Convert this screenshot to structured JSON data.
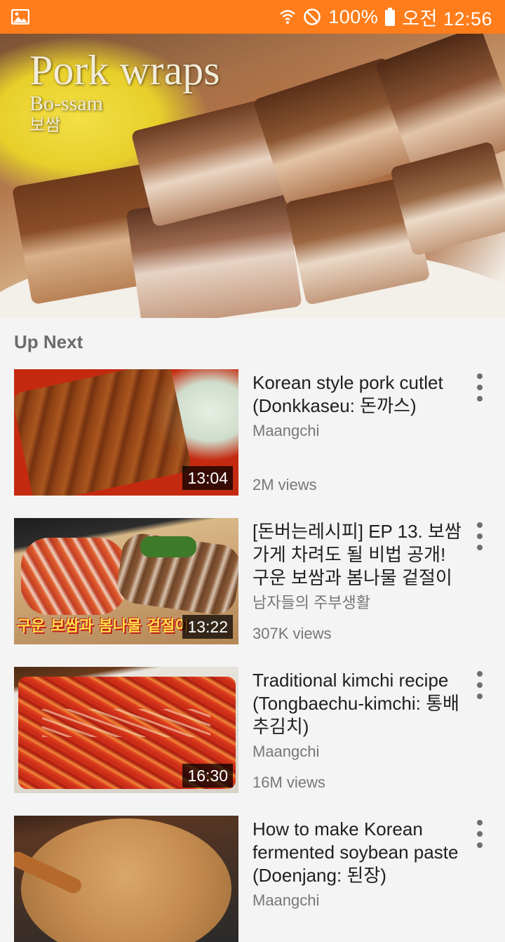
{
  "status_bar": {
    "battery": "100%",
    "time": "오전 12:56"
  },
  "player": {
    "title": "Pork wraps",
    "subtitle": "Bo-ssam",
    "subtitle_korean": "보쌈"
  },
  "section": {
    "title": "Up Next"
  },
  "videos": [
    {
      "title": "Korean style pork cutlet (Donkkaseu: 돈까스)",
      "channel": "Maangchi",
      "views": "2M views",
      "duration": "13:04"
    },
    {
      "title": "[돈버는레시피] EP 13. 보쌈 가게 차려도 될 비법 공개! 구운 보쌈과 봄나물 겉절이",
      "channel": "남자들의 주부생활",
      "views": "307K views",
      "duration": "13:22",
      "thumb_caption": "구운 보쌈과 봄나물 겉절이"
    },
    {
      "title": "Traditional kimchi recipe (Tongbaechu-kimchi: 통배추김치)",
      "channel": "Maangchi",
      "views": "16M views",
      "duration": "16:30"
    },
    {
      "title": "How to make Korean fermented soybean paste (Doenjang: 된장)",
      "channel": "Maangchi",
      "views": "",
      "duration": ""
    }
  ],
  "colors": {
    "status_bar": "#ff7d1a",
    "background": "#f4f4f4"
  }
}
